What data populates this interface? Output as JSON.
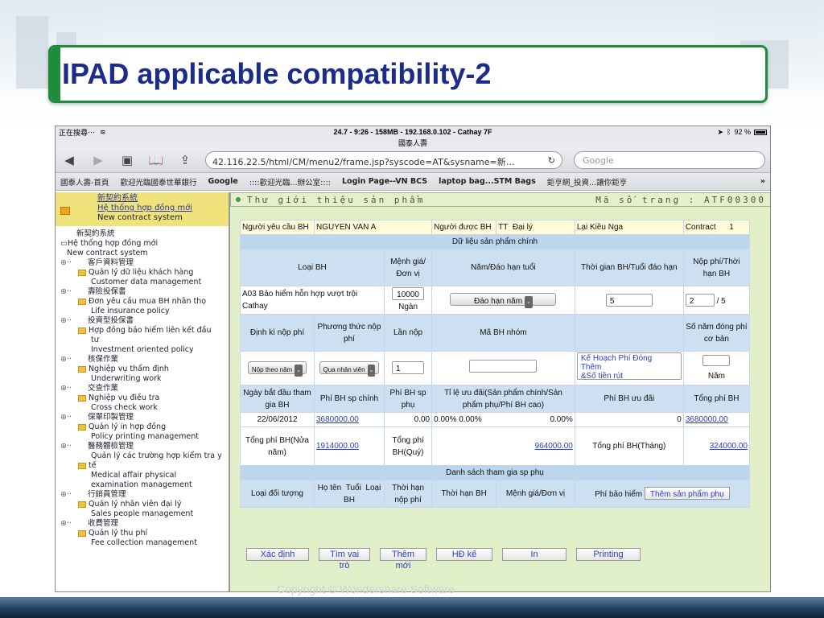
{
  "slide": {
    "title": "IPAD applicable compatibility-2",
    "copyright": "Copyright © Wondershare Software"
  },
  "statusbar": {
    "left": "正在搜尋⋯",
    "center": "24.7 - 9:26 - 158MB - 192.168.0.102 - Cathay 7F",
    "battery": "92 %"
  },
  "browser": {
    "page_title": "國泰人壽",
    "url": "42.116.22.5/html/CM/menu2/frame.jsp?syscode=AT&sysname=新…",
    "search_placeholder": "Google",
    "bookmarks": [
      "國泰人壽-首頁",
      "歡迎光臨國泰世華銀行",
      "Google",
      "::::歡迎光臨...辦公室::::",
      "Login Page--VN BCS",
      "laptop bag...STM Bags",
      "鉅亨網_投資...讓你鉅亨"
    ],
    "more": "»"
  },
  "leftnav": {
    "top_links": [
      "新契約系統",
      "Hệ thống hợp đồng mới"
    ],
    "top_text": "New contract system",
    "tree": [
      {
        "level": "l1",
        "text": "新契約系統"
      },
      {
        "level": "icon",
        "text": "Hệ thống hợp đồng mới"
      },
      {
        "level": "l1b",
        "text": "New contract system"
      },
      {
        "level": "pm",
        "text": "客戶資料管理"
      },
      {
        "level": "fold",
        "text": "Quản lý dữ liệu khách hàng"
      },
      {
        "level": "lbl",
        "text": "Customer data management"
      },
      {
        "level": "pm",
        "text": "壽險投保書"
      },
      {
        "level": "fold",
        "text": "Đơn yêu cầu mua BH nhân thọ"
      },
      {
        "level": "lbl",
        "text": "Life insurance policy"
      },
      {
        "level": "pm",
        "text": "投資型投保書"
      },
      {
        "level": "fold",
        "text": "Hợp đồng bảo hiểm liên kết đầu"
      },
      {
        "level": "lbl2",
        "text": "tư"
      },
      {
        "level": "lbl",
        "text": "Investment oriented policy"
      },
      {
        "level": "pm",
        "text": "核保作業"
      },
      {
        "level": "fold",
        "text": "Nghiệp vụ thẩm định"
      },
      {
        "level": "lbl",
        "text": "Underwriting work"
      },
      {
        "level": "pm",
        "text": "交查作業"
      },
      {
        "level": "fold",
        "text": "Nghiệp vụ điều tra"
      },
      {
        "level": "lbl",
        "text": "Cross check work"
      },
      {
        "level": "pm",
        "text": "保單印製管理"
      },
      {
        "level": "fold",
        "text": "Quản lý in hợp đồng"
      },
      {
        "level": "lbl",
        "text": "Policy printing management"
      },
      {
        "level": "pm",
        "text": "醫務體檢管理"
      },
      {
        "level": "lbl",
        "text": "Quản lý các trường hợp kiểm tra y"
      },
      {
        "level": "fold2",
        "text": "tế"
      },
      {
        "level": "lbl",
        "text": "Medical affair physical"
      },
      {
        "level": "lbl",
        "text": "examination management"
      },
      {
        "level": "pm",
        "text": "行銷員管理"
      },
      {
        "level": "fold",
        "text": "Quản lý nhân viên đại lý"
      },
      {
        "level": "lbl",
        "text": "Sales people management"
      },
      {
        "level": "pm",
        "text": "收費管理"
      },
      {
        "level": "fold",
        "text": "Quản lý thu phí"
      },
      {
        "level": "lbl",
        "text": "Fee collection management"
      }
    ]
  },
  "form": {
    "header_left": "Thư giới thiệu sản phẩm",
    "header_right": "Mã số trang : ATF00300",
    "row1": {
      "req_label": "Người yêu cầu BH",
      "req_value": "NGUYEN VAN A",
      "ins_label": "Người được BH",
      "tt": "TT",
      "agent_label": "Đại lý",
      "agent_value": "Lại Kiều Nga",
      "contract_label": "Contract",
      "contract_value": "1"
    },
    "main_section": "Dữ liệu sản phẩm chính",
    "main_headers": [
      "Loại BH",
      "Mệnh giá/Đơn vị",
      "Năm/Đáo hạn tuổi",
      "Thời gian BH/Tuổi đáo hạn",
      "Nộp phí/Thời hạn BH"
    ],
    "main_row": {
      "product": "A03 Bảo hiểm hỗn hợp vượt trội Cathay",
      "amount": "10000",
      "unit": "Ngàn",
      "term_select": "Đáo hạn năm",
      "term_value": "5",
      "pay_value": "2",
      "pay_suffix": "/ 5"
    },
    "pay_headers": [
      "Định kì nộp phí",
      "Phương thức nộp phí",
      "Lần nộp",
      "Mã BH nhóm",
      "",
      "Số năm đóng phí cơ bản"
    ],
    "pay_row": {
      "freq": "Nộp theo năm",
      "method": "Qua nhân viên",
      "times": "1",
      "group_code": "",
      "plan_line1": "Kế Hoạch Phí Đóng",
      "plan_line2": "Thêm",
      "plan_line3": "&Số tiền rút",
      "years_label": "Năm"
    },
    "date_headers": [
      "Ngày bắt đầu tham gia BH",
      "Phí BH sp chính",
      "Phí BH sp phụ",
      "Tỉ lệ ưu đãi(Sản phẩm chính/Sản phẩm phụ/Phí BH cao)",
      "Phí BH ưu đãi",
      "Tổng phí BH"
    ],
    "date_row": {
      "start": "22/06/2012",
      "main_fee": "3680000.00",
      "sub_fee": "0.00",
      "r1": "0.00%",
      "r2": "0.00%",
      "r3": "0.00%",
      "pref_fee": "0",
      "total": "3680000.00"
    },
    "half_row": {
      "label": "Tổng phí BH(Nửa năm)",
      "half_value": "1914000.00",
      "quarter_label": "Tổng phí BH(Quý)",
      "quarter_value": "964000.00",
      "month_label": "Tổng phí BH(Tháng)",
      "month_value": "324000.00"
    },
    "sub_section": "Danh sách tham gia sp phụ",
    "sub_headers": [
      "Loại đối tượng",
      "Họ tên",
      "Tuổi",
      "Loại BH",
      "Thời hạn nộp phí",
      "Thời hạn BH",
      "Mệnh giá/Đơn vị",
      "Phí bảo hiểm"
    ],
    "add_sub_button": "Thêm sản phẩm phụ",
    "buttons": [
      "Xác định",
      "Tìm vai trò",
      "Thêm mới",
      "HĐ kế",
      "In",
      "Printing"
    ]
  }
}
